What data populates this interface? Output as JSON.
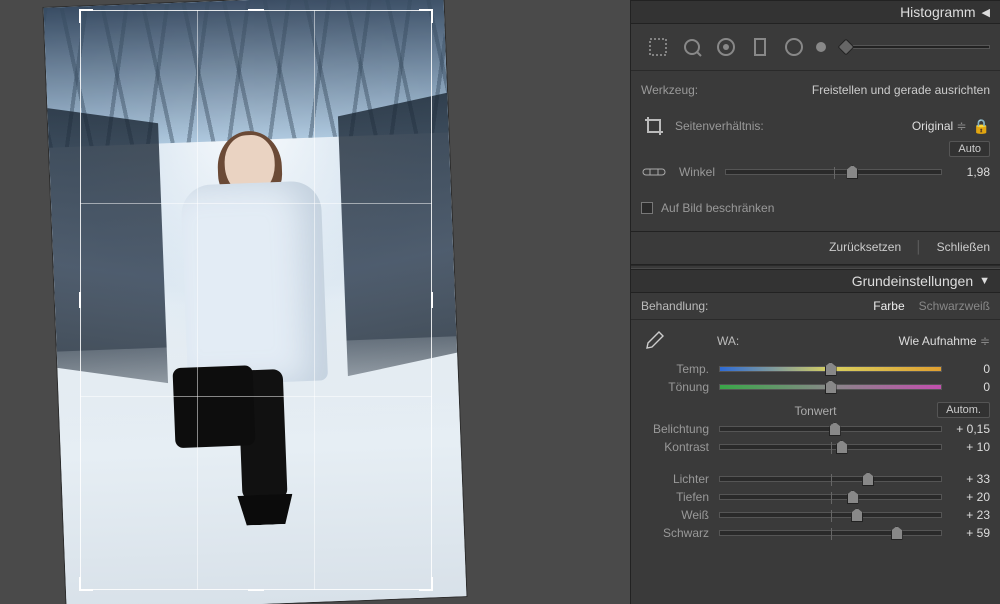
{
  "histogram_header": "Histogramm",
  "tool": {
    "label": "Werkzeug:",
    "name": "Freistellen und gerade ausrichten",
    "aspect": {
      "label": "Seitenverhältnis:",
      "value": "Original"
    },
    "angle": {
      "label": "Winkel",
      "value": "1,98",
      "auto_label": "Auto",
      "pos": 56
    },
    "constrain": {
      "label": "Auf Bild beschränken",
      "checked": false
    },
    "reset": "Zurücksetzen",
    "close": "Schließen"
  },
  "basic": {
    "header": "Grundeinstellungen",
    "treatment": {
      "label": "Behandlung:",
      "color": "Farbe",
      "bw": "Schwarzweiß"
    },
    "wb": {
      "label": "WA:",
      "value": "Wie Aufnahme"
    },
    "sliders": {
      "temp": {
        "label": "Temp.",
        "value": "0",
        "pos": 50
      },
      "tint": {
        "label": "Tönung",
        "value": "0",
        "pos": 50
      },
      "tone_header": "Tonwert",
      "auto_label": "Autom.",
      "exposure": {
        "label": "Belichtung",
        "value": "+ 0,15",
        "pos": 52
      },
      "contrast": {
        "label": "Kontrast",
        "value": "+ 10",
        "pos": 55
      },
      "highlights": {
        "label": "Lichter",
        "value": "+ 33",
        "pos": 67
      },
      "shadows": {
        "label": "Tiefen",
        "value": "+ 20",
        "pos": 60
      },
      "whites": {
        "label": "Weiß",
        "value": "+ 23",
        "pos": 62
      },
      "blacks": {
        "label": "Schwarz",
        "value": "+ 59",
        "pos": 80
      }
    }
  }
}
